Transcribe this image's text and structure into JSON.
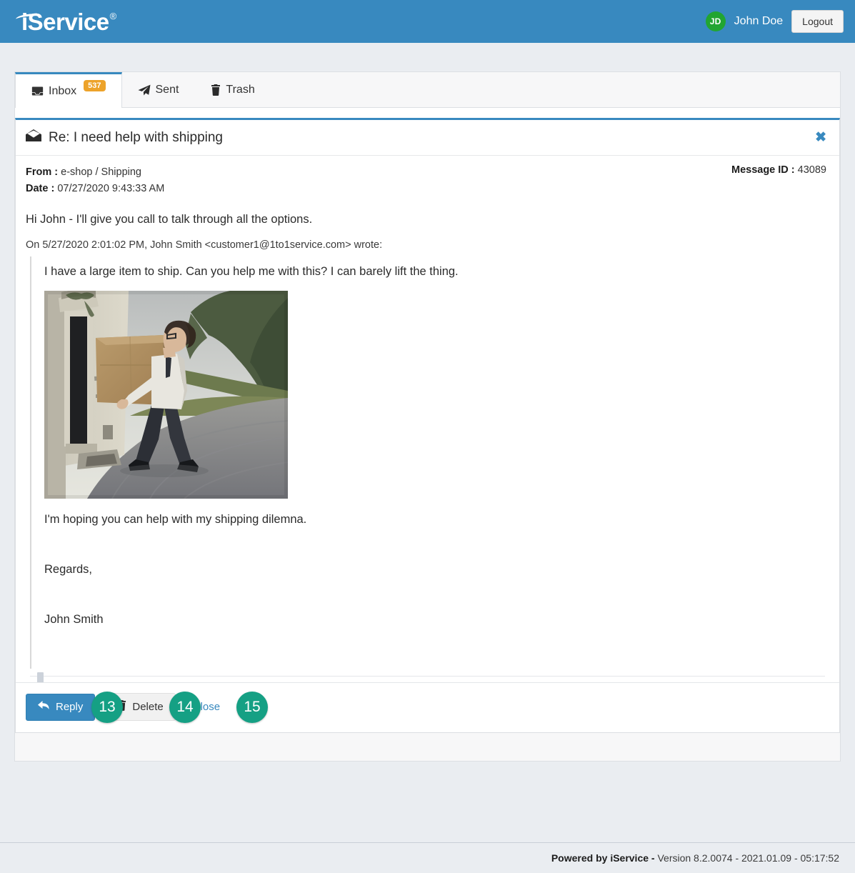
{
  "header": {
    "brand": "iService",
    "brand_trademark": "®",
    "avatar_initials": "JD",
    "user_name": "John Doe",
    "logout_label": "Logout",
    "bar_color": "#3889bf",
    "avatar_color": "#21a531"
  },
  "tabs": [
    {
      "label": "Inbox",
      "icon": "inbox-icon",
      "badge": "537",
      "active": true
    },
    {
      "label": "Sent",
      "icon": "paper-plane-icon",
      "badge": "",
      "active": false
    },
    {
      "label": "Trash",
      "icon": "trash-icon",
      "badge": "",
      "active": false
    }
  ],
  "message": {
    "subject": "Re: I need help with shipping",
    "envelope_icon": "open-envelope-icon",
    "close_icon": "close-x-icon",
    "from_label": "From :",
    "from_value": "e-shop / Shipping",
    "date_label": "Date :",
    "date_value": "07/27/2020 9:43:33 AM",
    "message_id_label": "Message ID :",
    "message_id_value": "43089",
    "reply_body": "Hi John - I'll give you call to talk through all the options.",
    "quote_header": "On 5/27/2020 2:01:02 PM, John Smith <customer1@1to1service.com> wrote:",
    "quoted_line1": "I have a large item to ship. Can you help me with this? I can barely lift the thing.",
    "quoted_image_alt": "man carrying a large cardboard box on a road",
    "quoted_line2": "I'm hoping you can help with my shipping dilemna.",
    "quoted_line3": "Regards,",
    "quoted_line4": "John Smith"
  },
  "actions": {
    "reply_label": "Reply",
    "reply_icon": "reply-arrow-icon",
    "delete_label": "Delete",
    "delete_icon": "trash-icon",
    "close_label": "Close",
    "badge_13": "13",
    "badge_14": "14",
    "badge_15": "15",
    "badge_color": "#15a084"
  },
  "footer": {
    "powered_by": "Powered by iService -",
    "version_text": "Version 8.2.0074 - 2021.01.09 - 05:17:52"
  }
}
